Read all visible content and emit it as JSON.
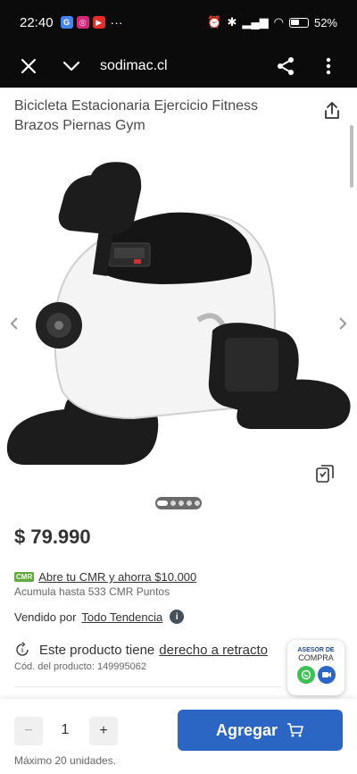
{
  "status_bar": {
    "time": "22:40",
    "battery": "52%"
  },
  "browser": {
    "url": "sodimac.cl"
  },
  "product": {
    "title": "Bicicleta Estacionaria Ejercicio Fitness Brazos Piernas Gym",
    "price": "$ 79.990",
    "cmr_badge": "CMR",
    "cmr_offer": "Abre tu CMR y ahorra $10.000",
    "cmr_points": "Acumula hasta 533 CMR Puntos",
    "sold_by_label": "Vendido por",
    "seller": "Todo Tendencia",
    "retracto_text": "Este producto tiene",
    "retracto_link": "derecho a retracto",
    "product_code": "Cód. del producto: 149995062"
  },
  "gallery": {
    "image_count": 5,
    "active_index": 0
  },
  "advisor": {
    "line1": "ASESOR DE",
    "line2": "COMPRA"
  },
  "cart": {
    "quantity": "1",
    "minus": "−",
    "plus": "+",
    "add_label": "Agregar",
    "max_units": "Máximo 20 unidades."
  },
  "icons": [
    "close-icon",
    "chevron-down-icon",
    "share-icon",
    "more-vert-icon",
    "upload-share-icon",
    "chevron-left-icon",
    "chevron-right-icon",
    "collection-icon",
    "info-icon",
    "return-icon",
    "whatsapp-icon",
    "video-icon",
    "cart-icon"
  ],
  "colors": {
    "primary": "#2b66c4",
    "cmr_green": "#5fa83a",
    "whatsapp": "#3cc154",
    "video": "#2b66c4"
  }
}
